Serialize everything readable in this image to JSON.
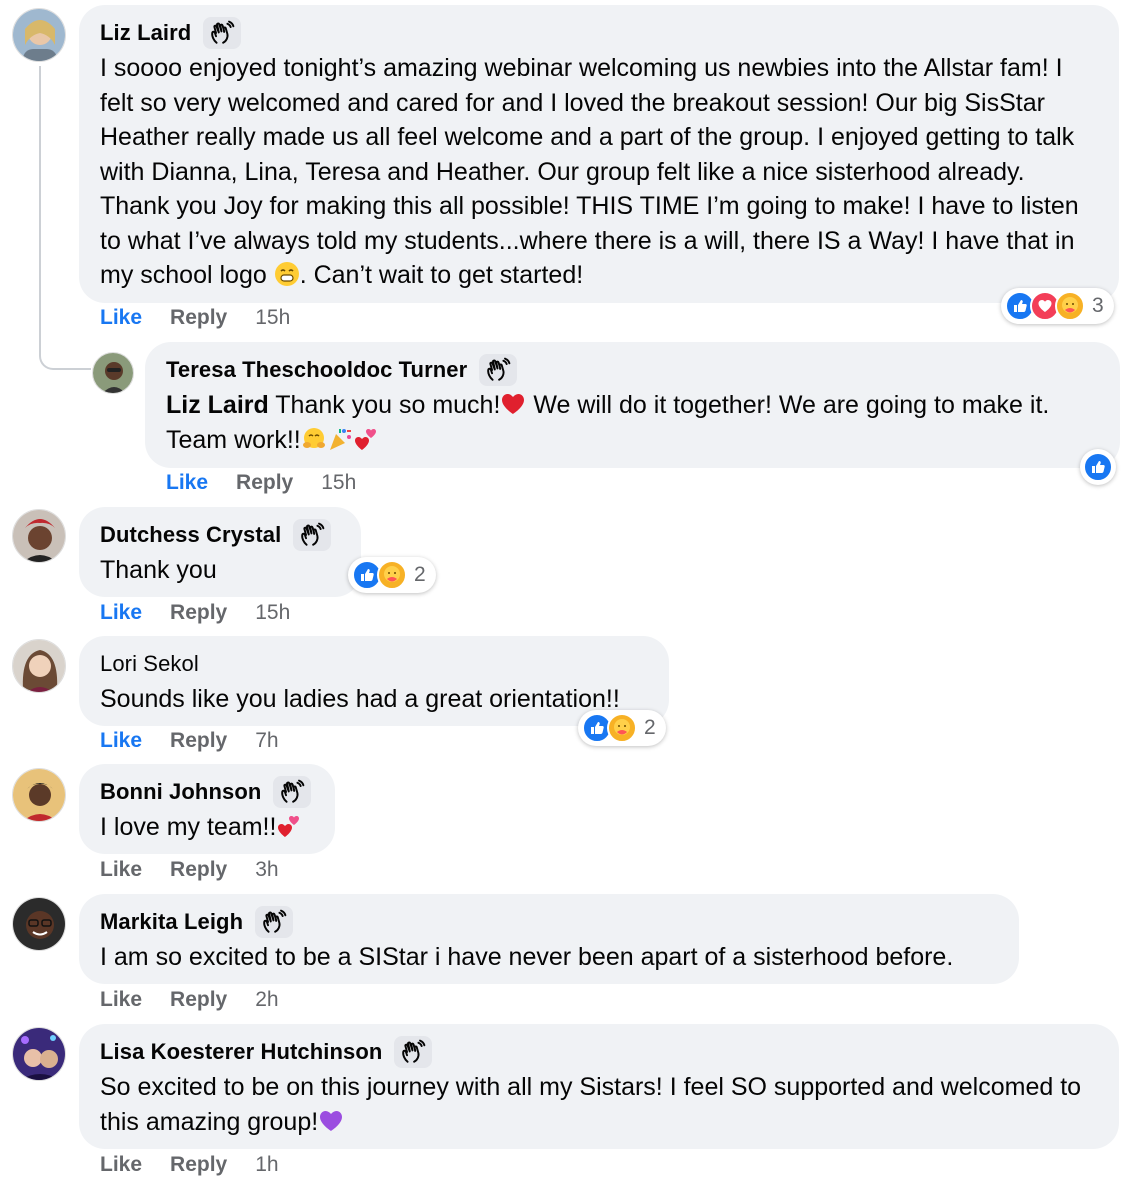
{
  "actions": {
    "like_label": "Like",
    "reply_label": "Reply"
  },
  "comments": [
    {
      "name": "Liz Laird",
      "text_parts": [
        "I soooo enjoyed tonight’s amazing webinar welcoming us newbies into the Allstar fam! I felt so very welcomed and cared for and I loved the breakout session! Our big SisStar Heather really made us all feel welcome and a part of the group. I enjoyed getting to talk with Dianna, Lina, Teresa and Heather. Our group felt like a nice sisterhood already. Thank you Joy for making this all possible! THIS TIME I’m going to make! I have to listen to what I’ve always told my students...where there is a will, there IS a Way! I have that in my school logo ",
        ". Can’t wait to get started!"
      ],
      "time": "15h",
      "reactions": {
        "icons": [
          "like-icon",
          "love-icon",
          "care-icon"
        ],
        "count": "3"
      },
      "liked": true
    },
    {
      "name": "Teresa Theschooldoc Turner",
      "mention": "Liz Laird",
      "text_parts": [
        " Thank you so much!",
        " We will do it together! We are going to make it. Team work!!"
      ],
      "time": "15h",
      "reactions": {
        "icons": [
          "like-icon"
        ],
        "count": ""
      },
      "liked": true
    },
    {
      "name": "Dutchess Crystal",
      "text": "Thank you",
      "time": "15h",
      "reactions": {
        "icons": [
          "like-icon",
          "care-icon"
        ],
        "count": "2"
      },
      "liked": true
    },
    {
      "name": "Lori Sekol",
      "text": "Sounds like you ladies had a great orientation!!",
      "time": "7h",
      "reactions": {
        "icons": [
          "like-icon",
          "care-icon"
        ],
        "count": "2"
      },
      "liked": true
    },
    {
      "name": "Bonni Johnson",
      "text": "I love my team!!",
      "time": "3h",
      "liked": false
    },
    {
      "name": "Markita Leigh",
      "text": "I am so excited to be a SIStar i have never been apart of a sisterhood before.",
      "time": "2h",
      "liked": false
    },
    {
      "name": "Lisa Koesterer Hutchinson",
      "text": "So excited to be on this journey with all my Sistars! I feel SO supported and welcomed to this amazing group!",
      "time": "1h",
      "liked": false
    }
  ],
  "colors": {
    "accent": "#1877f2",
    "bubble": "#f0f2f5",
    "secondary_text": "#65676b"
  }
}
